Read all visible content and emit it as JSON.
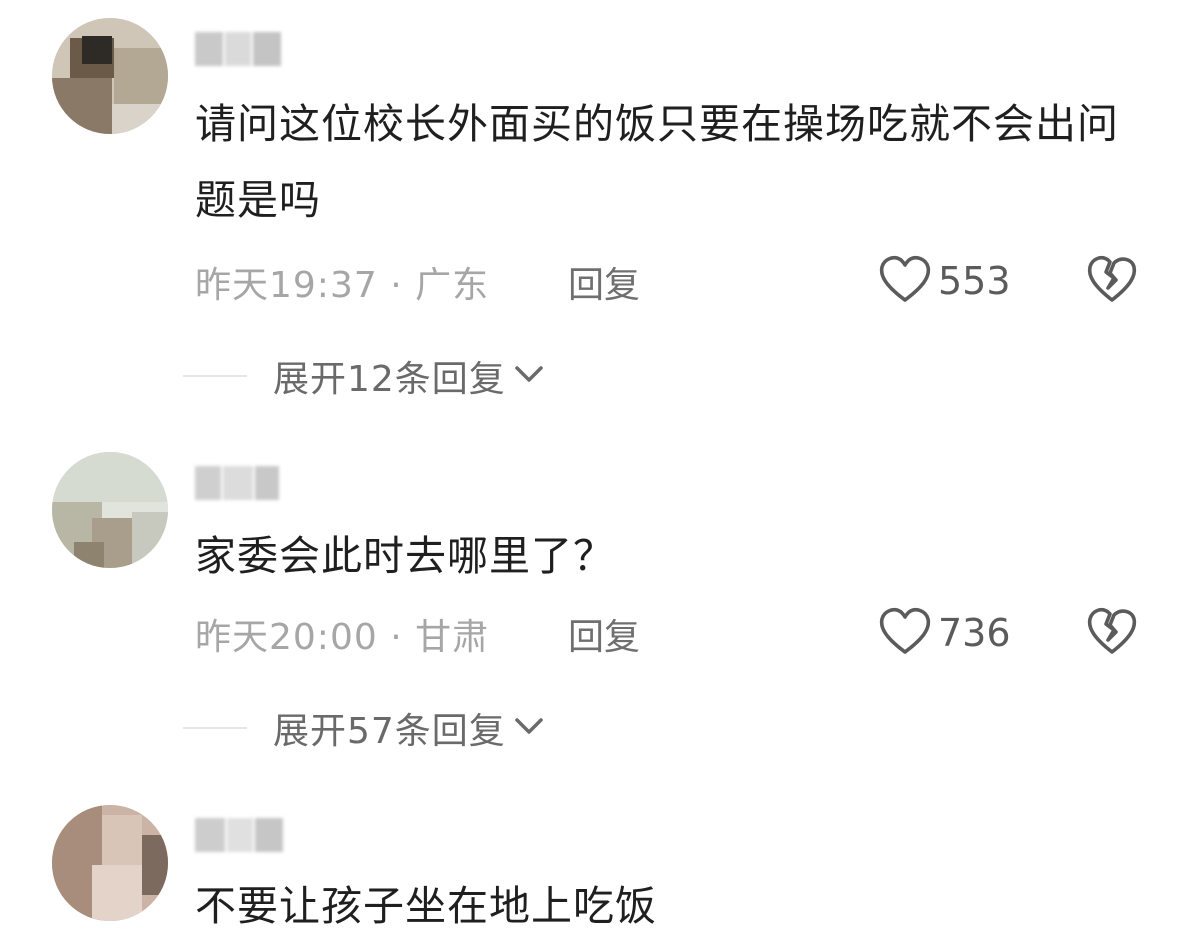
{
  "comments": [
    {
      "username": "小叔",
      "text": "请问这位校长外面买的饭只要在操场吃就不会出问题是吗",
      "time": "昨天19:37",
      "location": "广东",
      "reply_label": "回复",
      "likes": "553",
      "expand_label": "展开12条回复"
    },
    {
      "username": "",
      "text": "家委会此时去哪里了？",
      "time": "昨天20:00",
      "location": "甘肃",
      "reply_label": "回复",
      "likes": "736",
      "expand_label": "展开57条回复"
    },
    {
      "username": "",
      "text": "不要让孩子坐在地上吃饭"
    }
  ],
  "separator": " · ",
  "icons": {
    "like": "heart-outline-icon",
    "dislike": "broken-heart-icon",
    "expand": "chevron-down-icon"
  },
  "colors": {
    "text": "#1f1f1f",
    "meta": "#a6a6a6",
    "reply": "#6f6f6f"
  }
}
